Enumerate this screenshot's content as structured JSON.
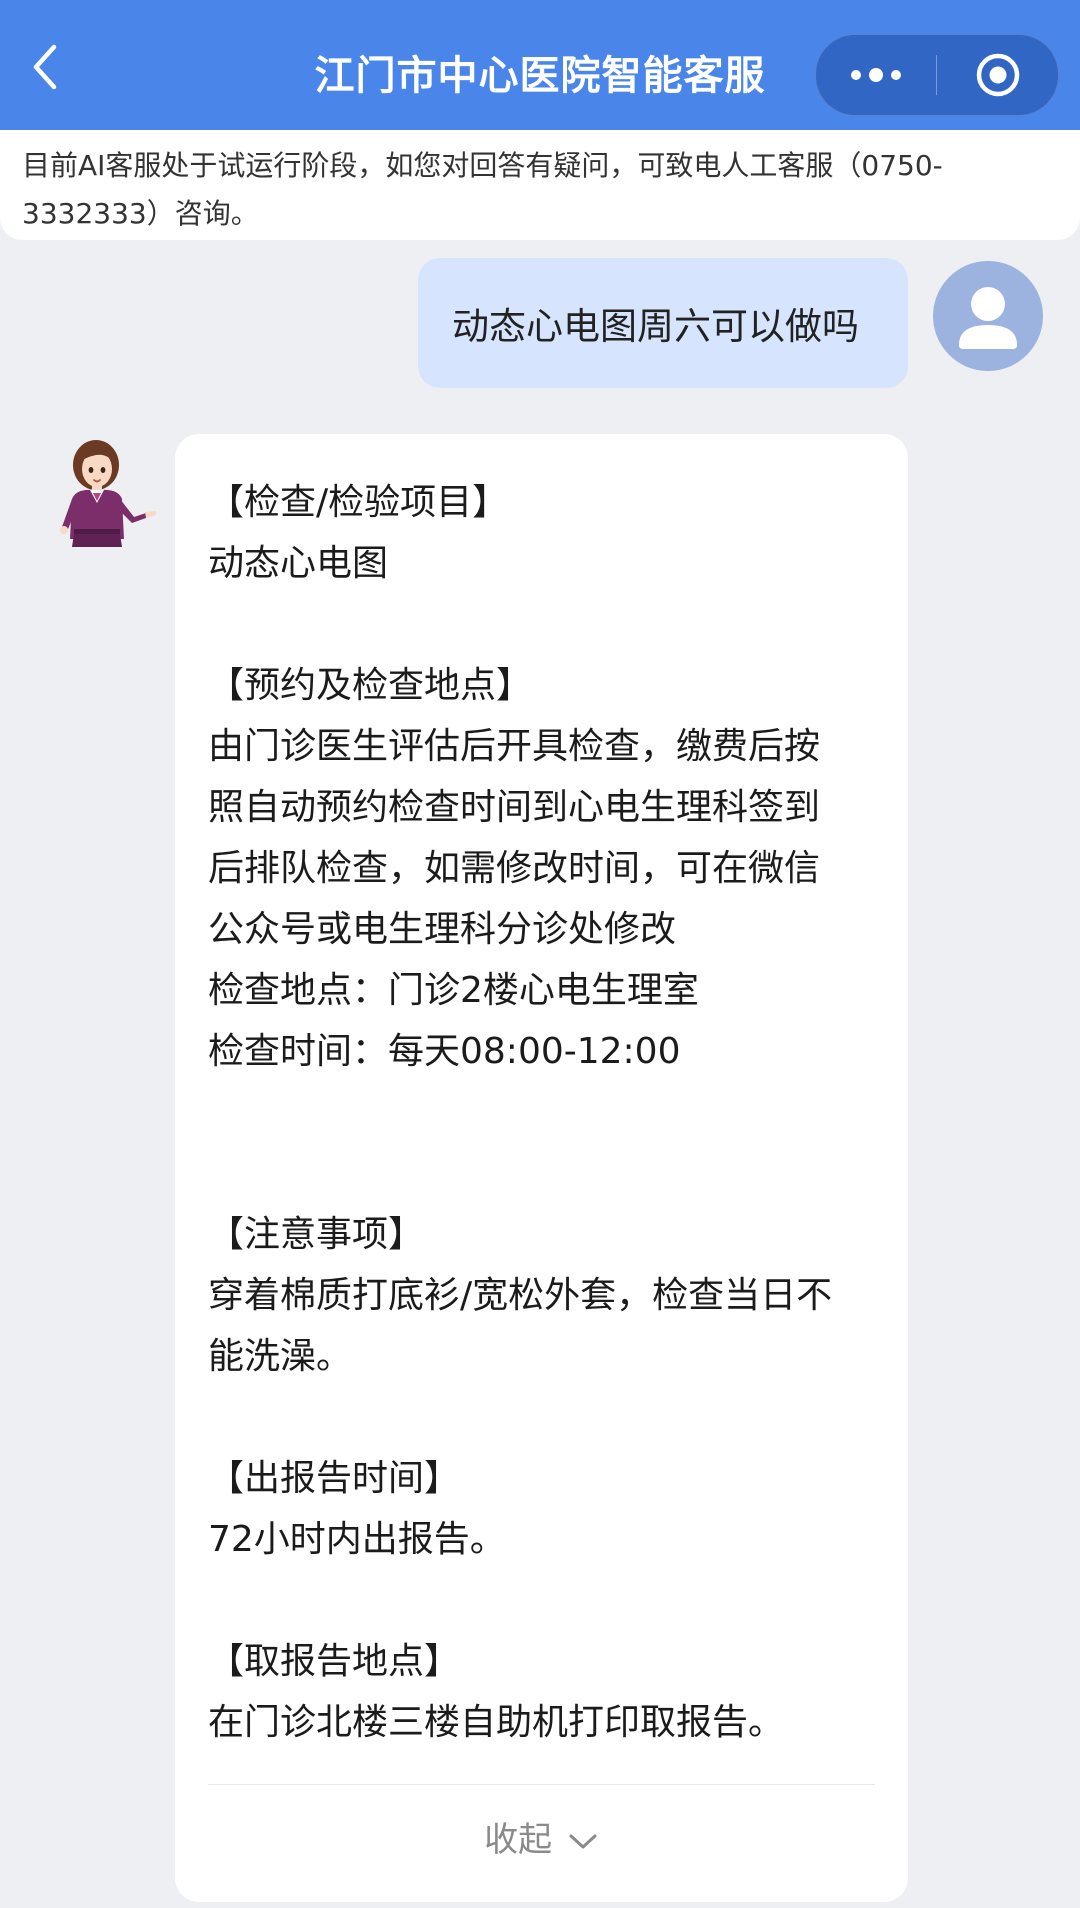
{
  "header": {
    "title": "江门市中心医院智能客服",
    "back_icon": "chevron-left-icon",
    "more_icon": "more-dots-icon",
    "close_icon": "target-circle-icon",
    "background_color": "#4a86ea"
  },
  "notice": {
    "line1": "目前AI客服处于试运行阶段，如您对回答有疑问，可致电人工客服（0750-",
    "line2": "3332333）咨询。"
  },
  "conversation": {
    "user_message": "动态心电图周六可以做吗",
    "user_avatar_icon": "user-avatar-icon",
    "bot_avatar_icon": "assistant-avatar-icon",
    "bot_reply": {
      "sections": [
        {
          "heading": "【检查/检验项目】",
          "lines": [
            "动态心电图"
          ]
        },
        {
          "heading": "【预约及检查地点】",
          "lines": [
            "由门诊医生评估后开具检查，缴费后按",
            "照自动预约检查时间到心电生理科签到",
            "后排队检查，如需修改时间，可在微信",
            "公众号或电生理科分诊处修改",
            "检查地点：门诊2楼心电生理室",
            "检查时间：每天08:00-12:00"
          ]
        },
        {
          "heading": "【注意事项】",
          "lines": [
            "穿着棉质打底衫/宽松外套，检查当日不",
            "能洗澡。"
          ]
        },
        {
          "heading": "【出报告时间】",
          "lines": [
            "72小时内出报告。"
          ]
        },
        {
          "heading": "【取报告地点】",
          "lines": [
            "在门诊北楼三楼自助机打印取报告。"
          ]
        }
      ],
      "collapse_label": "收起",
      "collapse_icon": "chevron-down-icon"
    }
  }
}
